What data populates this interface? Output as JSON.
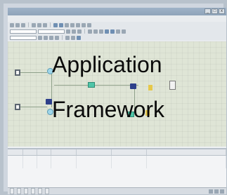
{
  "overlay": {
    "line1": "Application",
    "line2": "Framework"
  },
  "window": {
    "title": "",
    "buttons": [
      "_",
      "□",
      "x"
    ]
  },
  "menu": [
    "",
    "",
    "",
    "",
    "",
    "",
    "",
    ""
  ],
  "panel": {
    "columns": [
      "",
      "",
      "",
      "",
      "",
      "",
      ""
    ],
    "rows": [
      [
        "",
        "",
        "",
        "",
        "",
        "",
        ""
      ],
      [
        "",
        "",
        "",
        "",
        "",
        "",
        ""
      ],
      [
        "",
        "",
        "",
        "",
        "",
        "",
        ""
      ]
    ]
  },
  "statusbar": {
    "tabs": [
      "",
      "",
      "",
      "",
      "",
      "",
      "",
      ""
    ]
  },
  "colors": {
    "canvas_bg": "#dfe5d6",
    "node_green": "#4fc5a8",
    "node_navy": "#2d3f8a",
    "node_cyan": "#9fd6ea"
  }
}
